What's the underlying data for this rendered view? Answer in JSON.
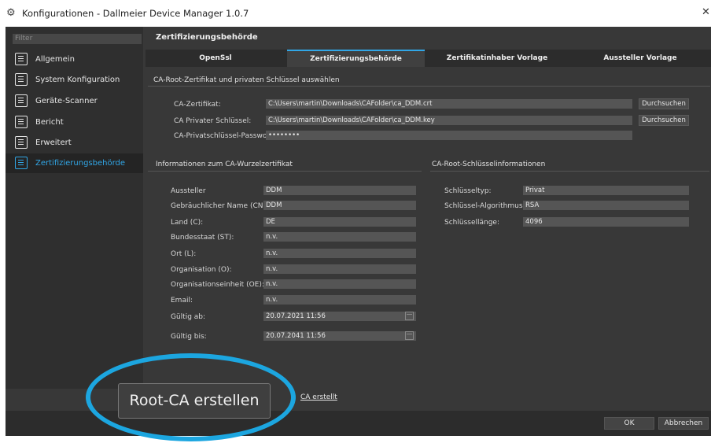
{
  "window": {
    "title": "Konfigurationen - Dallmeier Device Manager 1.0.7",
    "close": "✕"
  },
  "sidebar": {
    "filter_placeholder": "Filter",
    "items": [
      {
        "label": "Allgemein",
        "icon": "settings-icon"
      },
      {
        "label": "System Konfiguration",
        "icon": "system-config-icon"
      },
      {
        "label": "Geräte-Scanner",
        "icon": "scanner-icon"
      },
      {
        "label": "Bericht",
        "icon": "report-icon"
      },
      {
        "label": "Erweitert",
        "icon": "advanced-icon"
      },
      {
        "label": "Zertifizierungsbehörde",
        "icon": "certificate-icon",
        "active": true
      }
    ]
  },
  "main": {
    "heading": "Zertifizierungsbehörde",
    "tabs": [
      "OpenSsl",
      "Zertifizierungsbehörde",
      "Zertifikatinhaber Vorlage",
      "Aussteller Vorlage"
    ],
    "active_tab": "Zertifizierungsbehörde"
  },
  "ca_section": {
    "title": "CA-Root-Zertifikat und privaten Schlüssel auswählen",
    "cert_label": "CA-Zertifikat:",
    "cert_value": "C:\\Users\\martin\\Downloads\\CAFolder\\ca_DDM.crt",
    "key_label": "CA Privater Schlüssel:",
    "key_value": "C:\\Users\\martin\\Downloads\\CAFolder\\ca_DDM.key",
    "pw_label": "CA-Privatschlüssel-Passwort:",
    "pw_value": "••••••••",
    "browse": "Durchsuchen"
  },
  "info_section": {
    "title": "Informationen zum CA-Wurzelzertifikat",
    "rows": [
      {
        "label": "Aussteller",
        "value": "DDM"
      },
      {
        "label": "Gebräuchlicher Name (CN):",
        "value": "DDM"
      },
      {
        "label": "Land (C):",
        "value": "DE"
      },
      {
        "label": "Bundesstaat (ST):",
        "value": "n.v."
      },
      {
        "label": "Ort (L):",
        "value": "n.v."
      },
      {
        "label": "Organisation (O):",
        "value": "n.v."
      },
      {
        "label": "Organisationseinheit (OE):",
        "value": "n.v."
      },
      {
        "label": "Email:",
        "value": "n.v."
      },
      {
        "label": "Gültig ab:",
        "value": "20.07.2021 11:56"
      },
      {
        "label": "Gültig bis:",
        "value": "20.07.2041 11:56"
      }
    ]
  },
  "key_section": {
    "title": "CA-Root-Schlüsselinformationen",
    "rows": [
      {
        "label": "Schlüsseltyp:",
        "value": "Privat"
      },
      {
        "label": "Schlüssel-Algorithmus:",
        "value": "RSA"
      },
      {
        "label": "Schlüssellänge:",
        "value": "4096"
      }
    ]
  },
  "footer": {
    "create_button": "Root-CA erstellen",
    "link_text": "CA erstellt",
    "ok": "OK",
    "cancel": "Abbrechen"
  },
  "colors": {
    "accent": "#31a6e6",
    "highlight_ring": "#1ca6e0",
    "background": "#383838"
  }
}
